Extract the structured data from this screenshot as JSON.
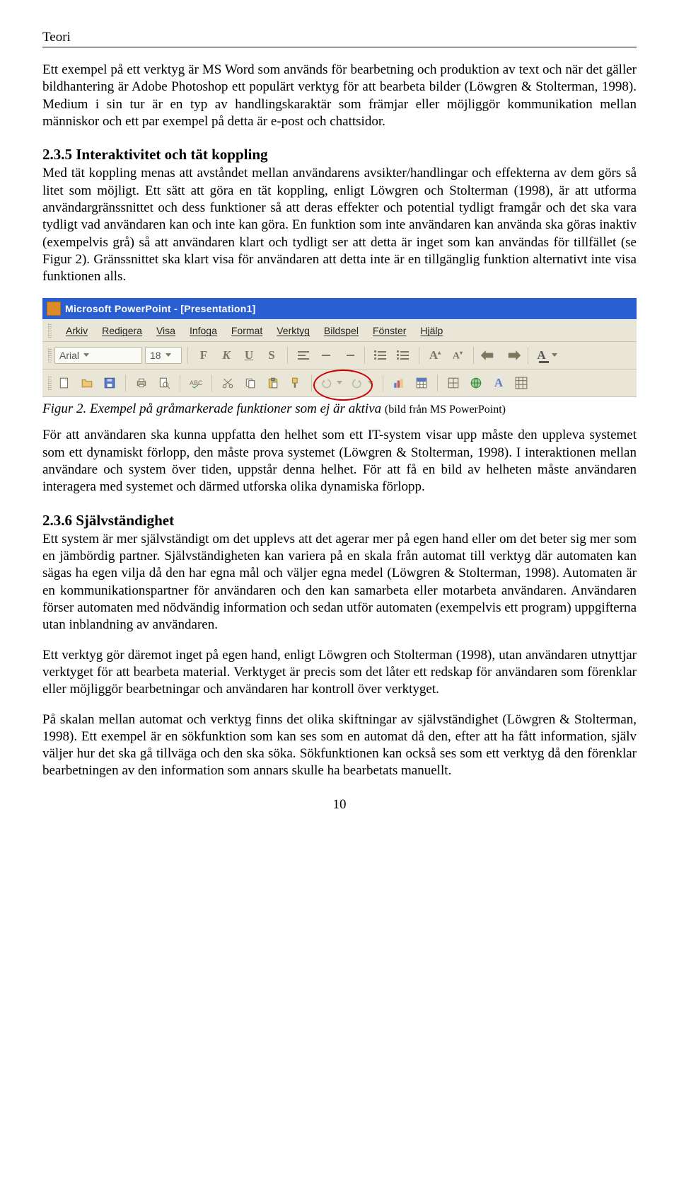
{
  "header": "Teori",
  "p1": "Ett exempel på ett verktyg är MS Word som används för bearbetning och produktion av text och när det gäller bildhantering är Adobe Photoshop ett populärt verktyg för att bearbeta bilder (Löwgren & Stolterman, 1998). Medium i sin tur är en typ av handlingskaraktär som främjar eller möjliggör kommunikation mellan människor och ett par exempel på detta är e-post och chattsidor.",
  "s1_title": "2.3.5 Interaktivitet och tät koppling",
  "p2": "Med tät koppling menas att avståndet mellan användarens avsikter/handlingar och effekterna av dem görs så litet som möjligt. Ett sätt att göra en tät koppling, enligt Löwgren och Stolterman (1998), är att utforma användargränssnittet och dess funktioner så att deras effekter och potential tydligt framgår och det ska vara tydligt vad användaren kan och inte kan göra. En funktion som inte användaren kan använda ska göras inaktiv (exempelvis grå) så att användaren klart och tydligt ser att detta är inget som kan användas för tillfället (se Figur 2). Gränssnittet ska klart visa för användaren att detta inte är en tillgänglig funktion alternativt inte visa funktionen alls.",
  "pp": {
    "title": "Microsoft PowerPoint - [Presentation1]",
    "menu": [
      "Arkiv",
      "Redigera",
      "Visa",
      "Infoga",
      "Format",
      "Verktyg",
      "Bildspel",
      "Fönster",
      "Hjälp"
    ],
    "font_name": "Arial",
    "font_size": "18"
  },
  "fig_caption": "Figur 2.  Exempel på gråmarkerade funktioner som ej är aktiva ",
  "fig_caption_src": "(bild från MS PowerPoint)",
  "p3": "För att användaren ska kunna uppfatta den helhet som ett IT-system visar upp måste den uppleva systemet som ett dynamiskt förlopp, den måste prova systemet (Löwgren & Stolterman, 1998). I interaktionen mellan användare och system över tiden, uppstår denna helhet. För att få en bild av helheten måste användaren interagera med systemet och därmed utforska olika dynamiska förlopp.",
  "s2_title": "2.3.6 Självständighet",
  "p4": "Ett system är mer självständigt om det upplevs att det agerar mer på egen hand eller om det beter sig mer som en jämbördig partner. Självständigheten kan variera på en skala från automat till verktyg där automaten kan sägas ha egen vilja då den har egna mål och väljer egna medel (Löwgren & Stolterman, 1998). Automaten är en kommunikationspartner för användaren och den kan samarbeta eller motarbeta användaren. Användaren förser automaten med nödvändig information och sedan utför automaten (exempelvis ett program) uppgifterna utan inblandning av användaren.",
  "p5": "Ett verktyg gör däremot inget på egen hand, enligt Löwgren och Stolterman (1998), utan användaren utnyttjar verktyget för att bearbeta material. Verktyget är precis som det låter ett redskap för användaren som förenklar eller möjliggör bearbetningar och användaren har kontroll över verktyget.",
  "p6": "På skalan mellan automat och verktyg finns det olika skiftningar av självständighet (Löwgren & Stolterman, 1998). Ett exempel är en sökfunktion som kan ses som en automat då den, efter att ha fått information, själv väljer hur det ska gå tillväga och den ska söka. Sökfunktionen kan också ses som ett verktyg då den förenklar bearbetningen av den information som annars skulle ha bearbetats manuellt.",
  "page_number": "10"
}
